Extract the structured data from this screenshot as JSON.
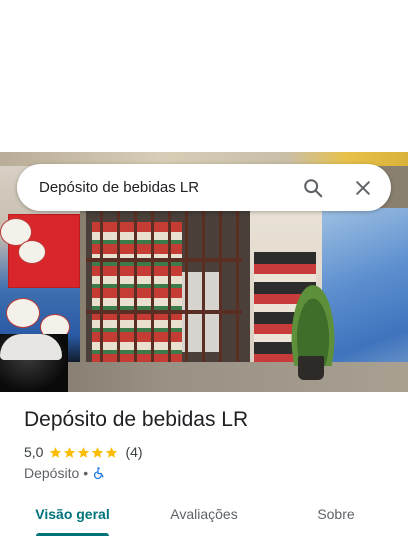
{
  "search": {
    "query": "Depósito de bebidas LR",
    "search_icon": "search-icon",
    "close_icon": "close-icon"
  },
  "place": {
    "name": "Depósito de bebidas LR",
    "rating": "5,0",
    "stars": 5,
    "review_count": "(4)",
    "category": "Depósito",
    "separator": "•",
    "accessibility_icon": "wheelchair-icon"
  },
  "tabs": [
    {
      "label": "Visão geral",
      "active": true
    },
    {
      "label": "Avaliações",
      "active": false
    },
    {
      "label": "Sobre",
      "active": false
    }
  ],
  "colors": {
    "accent": "#00737a",
    "star": "#fbbc04",
    "accessibility": "#1a73e8",
    "text_primary": "#202124",
    "text_secondary": "#5f6368"
  }
}
